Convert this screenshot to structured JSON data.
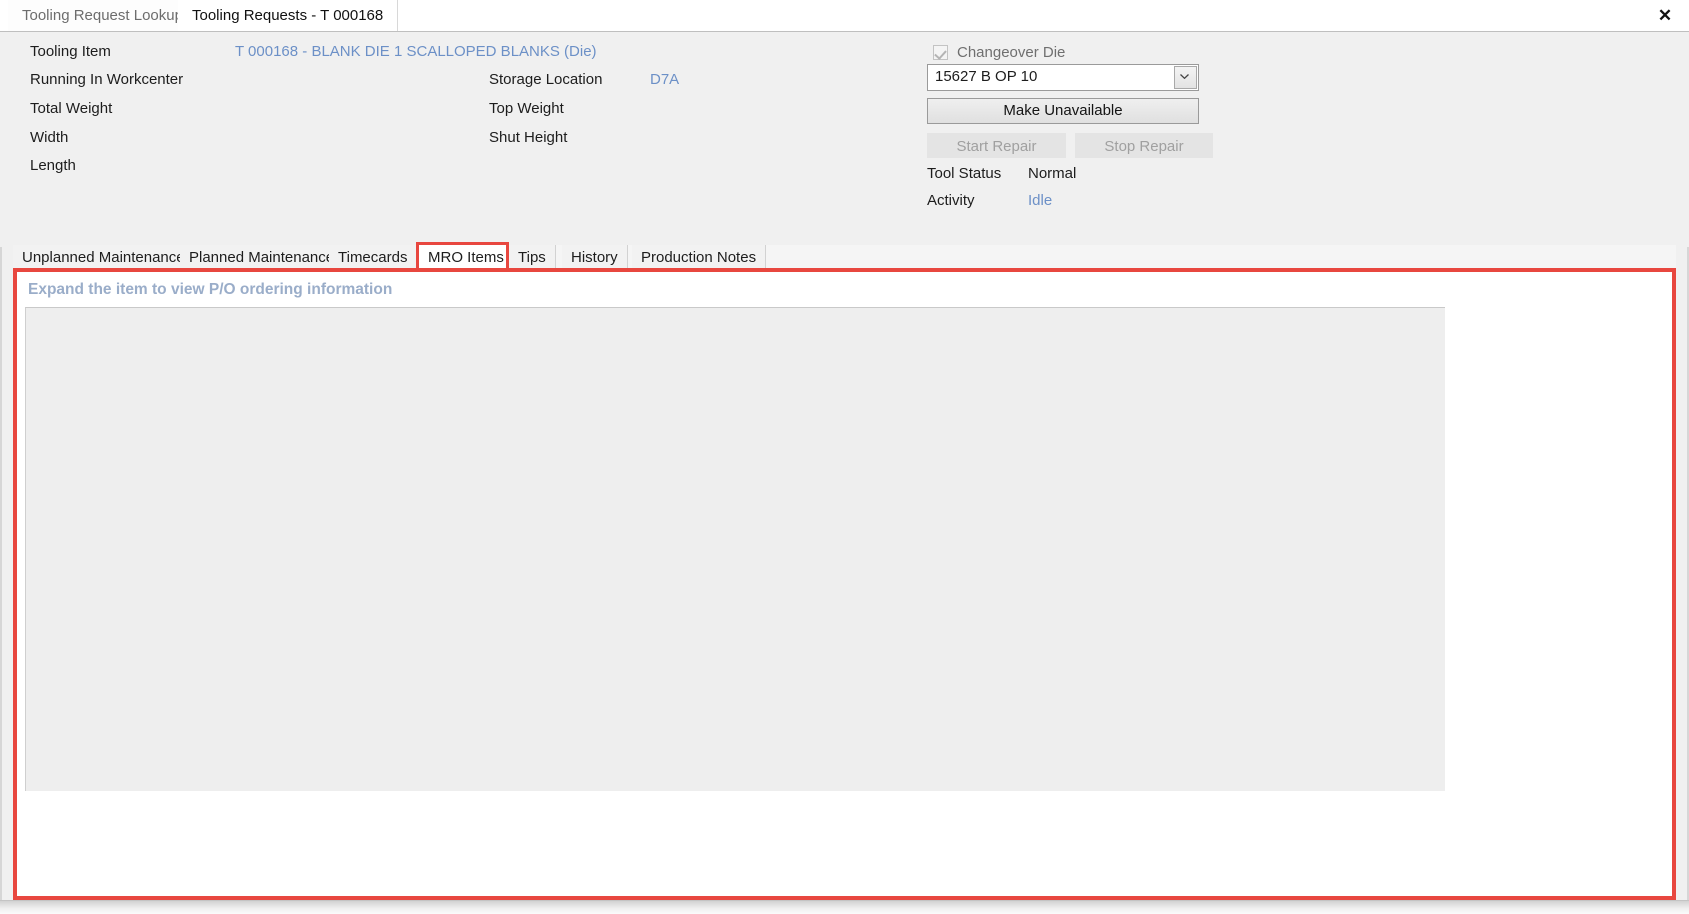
{
  "window": {
    "close_icon": "close-icon",
    "close_glyph": "✕",
    "tabs": [
      {
        "label": "Tooling Request Lookup",
        "active": false
      },
      {
        "label": "Tooling Requests - T 000168",
        "active": true
      }
    ]
  },
  "detail": {
    "fields": [
      {
        "label": "Tooling Item",
        "value": "T 000168 - BLANK DIE 1 SCALLOPED BLANKS (Die)",
        "link": true
      },
      {
        "label": "Running In Workcenter",
        "value": "",
        "link": false
      },
      {
        "label": "Total Weight",
        "value": "",
        "link": false
      },
      {
        "label": "Width",
        "value": "",
        "link": false
      },
      {
        "label": "Length",
        "value": "",
        "link": false
      }
    ],
    "fields_col2": [
      {
        "label": "Storage Location",
        "value": "D7A",
        "link": true
      },
      {
        "label": "Top Weight",
        "value": "",
        "link": false
      },
      {
        "label": "Shut Height",
        "value": "",
        "link": false
      }
    ],
    "changeover": {
      "label": "Changeover Die",
      "checked": true,
      "enabled": false
    },
    "operation_combo": {
      "value": "15627 B  OP 10",
      "chevron_icon": "chevron-down-icon"
    },
    "buttons": [
      {
        "label": "Make Unavailable",
        "enabled": true
      },
      {
        "label": "Start Repair",
        "enabled": false
      },
      {
        "label": "Stop Repair",
        "enabled": false
      }
    ],
    "status": [
      {
        "label": "Tool Status",
        "value": "Normal",
        "link": false
      },
      {
        "label": "Activity",
        "value": "Idle",
        "link": true
      }
    ]
  },
  "inner_tabs": [
    {
      "label": "Unplanned Maintenance",
      "selected": false
    },
    {
      "label": "Planned Maintenance",
      "selected": false
    },
    {
      "label": "Timecards",
      "selected": false
    },
    {
      "label": "MRO Items",
      "selected": true
    },
    {
      "label": "Tips",
      "selected": false
    },
    {
      "label": "History",
      "selected": false
    },
    {
      "label": "Production Notes",
      "selected": false
    }
  ],
  "mro_panel": {
    "hint": "Expand the item to view P/O ordering information",
    "grid_rows": []
  },
  "colors": {
    "link": "#6c90c7",
    "hint": "#9aadc9",
    "annotation": "#e8473f",
    "panel": "#f0f0f0",
    "grid": "#eeeeee"
  }
}
